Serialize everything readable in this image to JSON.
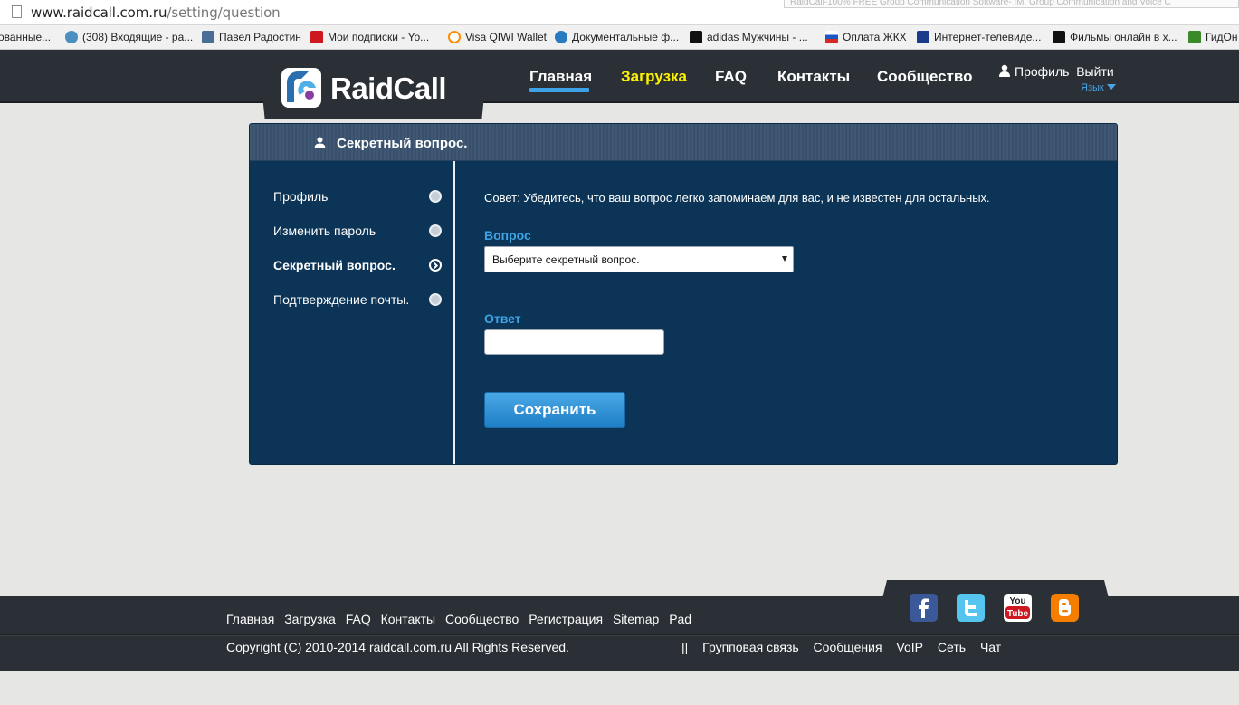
{
  "browser": {
    "url_host": "www.raidcall.com.ru",
    "url_path": "/setting/question",
    "tab_title": "RaidCall-100% FREE Group Communication Software- IM, Group Communication and Voice C",
    "bookmarks": [
      {
        "label": "ованные...",
        "icon": "none",
        "color": "#f1f1f1"
      },
      {
        "label": "(308) Входящие - ра...",
        "icon": "mail-icon",
        "color": "#4a8fc0"
      },
      {
        "label": "Павел Радостин",
        "icon": "vk-icon",
        "color": "#4a6c95"
      },
      {
        "label": "Мои подписки - Yo...",
        "icon": "youtube-icon",
        "color": "#cc181e"
      },
      {
        "label": "Visa QIWI Wallet",
        "icon": "qiwi-icon",
        "color": "#ff8c00"
      },
      {
        "label": "Документальные ф...",
        "icon": "doc-icon",
        "color": "#2a7ac0"
      },
      {
        "label": "adidas Мужчины - ...",
        "icon": "adidas-icon",
        "color": "#111111"
      },
      {
        "label": "Оплата ЖКХ",
        "icon": "flag-ru-icon",
        "color": "#d52b1e"
      },
      {
        "label": "Интернет-телевиде...",
        "icon": "tv-icon",
        "color": "#1a3a8a"
      },
      {
        "label": "Фильмы онлайн в х...",
        "icon": "hd-icon",
        "color": "#111111"
      },
      {
        "label": "ГидОн",
        "icon": "gid-icon",
        "color": "#3a8a2a"
      }
    ]
  },
  "header": {
    "logo_text": "RaidCall",
    "nav": [
      {
        "label": "Главная",
        "color": "#ffffff",
        "active": true
      },
      {
        "label": "Загрузка",
        "color": "#fff200",
        "active": false
      },
      {
        "label": "FAQ",
        "color": "#ffffff",
        "active": false
      },
      {
        "label": "Контакты",
        "color": "#ffffff",
        "active": false
      },
      {
        "label": "Сообщество",
        "color": "#ffffff",
        "active": false
      }
    ],
    "profile_label": "Профиль",
    "logout_label": "Выйти",
    "language_label": "Язык"
  },
  "panel": {
    "title": "Секретный вопрос.",
    "sidebar": [
      {
        "label": "Профиль",
        "active": false
      },
      {
        "label": "Изменить пароль",
        "active": false
      },
      {
        "label": "Секретный вопрос.",
        "active": true
      },
      {
        "label": "Подтверждение почты.",
        "active": false
      }
    ],
    "tip": "Совет: Убедитесь, что ваш вопрос легко запоминаем для вас, и не известен для остальных.",
    "question_label": "Вопрос",
    "question_select_value": "Выберите секретный вопрос.",
    "answer_label": "Ответ",
    "answer_value": "",
    "save_label": "Сохранить"
  },
  "footer": {
    "links": [
      "Главная",
      "Загрузка",
      "FAQ",
      "Контакты",
      "Сообщество",
      "Регистрация",
      "Sitemap",
      "Pad"
    ],
    "copyright": "Copyright (C) 2010-2014 raidcall.com.ru All Rights Reserved.",
    "separator": "||",
    "links2": [
      "Групповая связь",
      "Сообщения",
      "VoIP",
      "Сеть",
      "Чат"
    ],
    "social": [
      {
        "name": "facebook",
        "color": "#3b5998"
      },
      {
        "name": "twitter",
        "color": "#55c5ef"
      },
      {
        "name": "youtube",
        "color": "#cc181e"
      },
      {
        "name": "blogger",
        "color": "#f57d00"
      }
    ]
  },
  "colors": {
    "accent": "#3ea3e6",
    "header_bg": "#2b3036",
    "panel_bg": "#0c3456"
  }
}
